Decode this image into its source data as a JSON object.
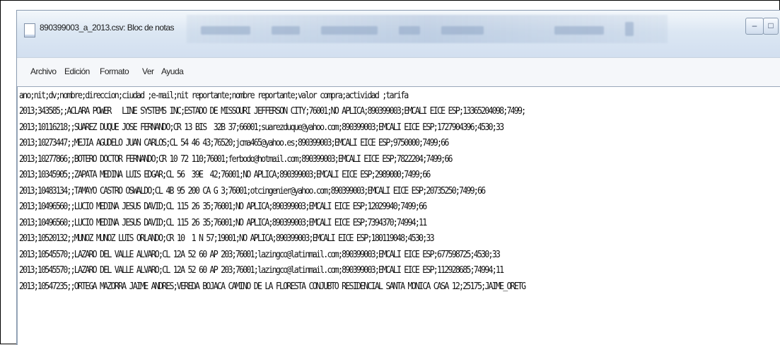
{
  "window": {
    "title": "890399003_a_2013.csv: Bloc de notas",
    "icon": "notepad-icon",
    "controls": {
      "minimize": "–",
      "maximize": "□"
    }
  },
  "menu": {
    "items": [
      "Archivo",
      "Edición",
      "Formato",
      "Ver",
      "Ayuda"
    ]
  },
  "editor": {
    "lines": [
      "ano;nit;dv;nombre;direccion;ciudad ;e-mail;nit reportante;nombre reportante;valor compra;actividad ;tarifa",
      "2013;343585;;ACLARA POWER   LINE SYSTEMS INC;ESTADO DE MISSOURI JEFFERSON CITY;76001;NO APLICA;890399003;EMCALI EICE ESP;13365204098;7499;",
      "2013;10116218;;SUAREZ DUQUE JOSE FERNANDO;CR 13 BIS  32B 37;66001;suarezduque@yahoo.com;890399003;EMCALI EICE ESP;1727904396;4530;33",
      "2013;10273447;;MEJIA AGUDELO JUAN CARLOS;CL 54 46 43;76520;jcma465@yahoo.es;890399003;EMCALI EICE ESP;9750000;7499;66",
      "2013;10277866;;BOTERO DOCTOR FERNANDO;CR 10 72 110;76001;ferbodo@hotmail.com;890399003;EMCALI EICE ESP;7822204;7499;66",
      "2013;10345905;;ZAPATA MEDINA LUIS EDGAR;CL 56  39E  42;76001;NO APLICA;890399003;EMCALI EICE ESP;2989000;7499;66",
      "2013;10483134;;TAMAYO CASTRO OSWALDO;CL 4B 95 200 CA G 3;76001;otcingenier@yahoo.com;890399003;EMCALI EICE ESP;20735250;7499;66",
      "2013;10496560;;LUCIO MEDINA JESUS DAVID;CL 115 26 35;76001;NO APLICA;890399003;EMCALI EICE ESP;12029940;7499;66",
      "2013;10496560;;LUCIO MEDINA JESUS DAVID;CL 115 26 35;76001;NO APLICA;890399003;EMCALI EICE ESP;7394370;74994;11",
      "2013;10520132;;MUNOZ MUNOZ LUIS ORLANDO;CR 10  1 N 57;19001;NO APLICA;890399003;EMCALI EICE ESP;180119048;4530;33",
      "2013;10545570;;LAZARO DEL VALLE ALVARO;CL 12A 52 60 AP 203;76001;lazingco@latinmail.com;890399003;EMCALI EICE ESP;677598725;4530;33",
      "2013;10545570;;LAZARO DEL VALLE ALVARO;CL 12A 52 60 AP 203;76001;lazingco@latinmail.com;890399003;EMCALI EICE ESP;112928685;74994;11",
      "2013;10547235;;ORTEGA MAZORRA JAIME ANDRES;VEREDA BOJACA CAMINO DE LA FLORESTA CONJUBTO RESIDENCIAL SANTA MONICA CASA 12;25175;JAIME_ORETG"
    ]
  }
}
